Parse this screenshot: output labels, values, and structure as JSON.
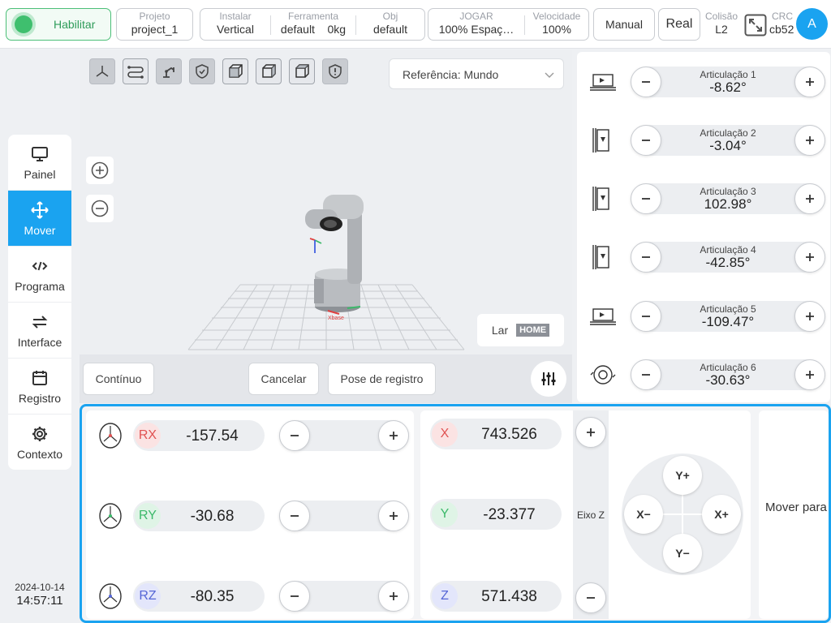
{
  "topbar": {
    "enable_label": "Habilitar",
    "project": {
      "label": "Projeto",
      "value": "project_1"
    },
    "install": {
      "label": "Instalar",
      "value": "Vertical"
    },
    "tool": {
      "label": "Ferramenta",
      "name": "default",
      "weight": "0kg"
    },
    "obj": {
      "label": "Obj",
      "value": "default"
    },
    "jog": {
      "label": "JOGAR",
      "value": "100%  Espaç…"
    },
    "speed": {
      "label": "Velocidade",
      "value": "100%"
    },
    "manual_label": "Manual",
    "real_label": "Real",
    "collision": {
      "label": "Colisão",
      "value": "L2"
    },
    "crc": {
      "label": "CRC",
      "value": "cb52"
    },
    "avatar_letter": "A"
  },
  "nav": {
    "items": [
      {
        "label": "Painel",
        "icon": "monitor-icon"
      },
      {
        "label": "Mover",
        "icon": "move-arrows-icon"
      },
      {
        "label": "Programa",
        "icon": "code-icon"
      },
      {
        "label": "Interface",
        "icon": "swap-arrows-icon"
      },
      {
        "label": "Registro",
        "icon": "calendar-icon"
      },
      {
        "label": "Contexto",
        "icon": "gear-icon"
      }
    ],
    "active": "Mover"
  },
  "datetime": {
    "date": "2024-10-14",
    "time": "14:57:11"
  },
  "viewport": {
    "reference": "Referência: Mundo",
    "home_label": "Lar",
    "home_tag": "HOME",
    "axis_label": "Xbase",
    "continuous_label": "Contínuo",
    "cancel_label": "Cancelar",
    "record_pose_label": "Pose de registro"
  },
  "joints": [
    {
      "name": "Articulação 1",
      "value": "-8.62°"
    },
    {
      "name": "Articulação 2",
      "value": "-3.04°"
    },
    {
      "name": "Articulação 3",
      "value": "102.98°"
    },
    {
      "name": "Articulação 4",
      "value": "-42.85°"
    },
    {
      "name": "Articulação 5",
      "value": "-109.47°"
    },
    {
      "name": "Articulação 6",
      "value": "-30.63°"
    }
  ],
  "rotation": [
    {
      "axis": "RX",
      "value": "-157.54",
      "color": "#e05252",
      "bg": "#fbe3e3"
    },
    {
      "axis": "RY",
      "value": "-30.68",
      "color": "#3cb96a",
      "bg": "#dff4e6"
    },
    {
      "axis": "RZ",
      "value": "-80.35",
      "color": "#5566d6",
      "bg": "#e3e6fb"
    }
  ],
  "position": [
    {
      "axis": "X",
      "value": "743.526",
      "color": "#e05252",
      "bg": "#fbe3e3"
    },
    {
      "axis": "Y",
      "value": "-23.377",
      "color": "#3cb96a",
      "bg": "#dff4e6"
    },
    {
      "axis": "Z",
      "value": "571.438",
      "color": "#5566d6",
      "bg": "#e3e6fb"
    }
  ],
  "zaxis_label": "Eixo Z",
  "dpad": {
    "up": "Y+",
    "down": "Y−",
    "left": "X−",
    "right": "X+"
  },
  "move_to_label": "Mover para",
  "colors": {
    "accent": "#1aa3f0",
    "enable": "#3fbf6e"
  }
}
